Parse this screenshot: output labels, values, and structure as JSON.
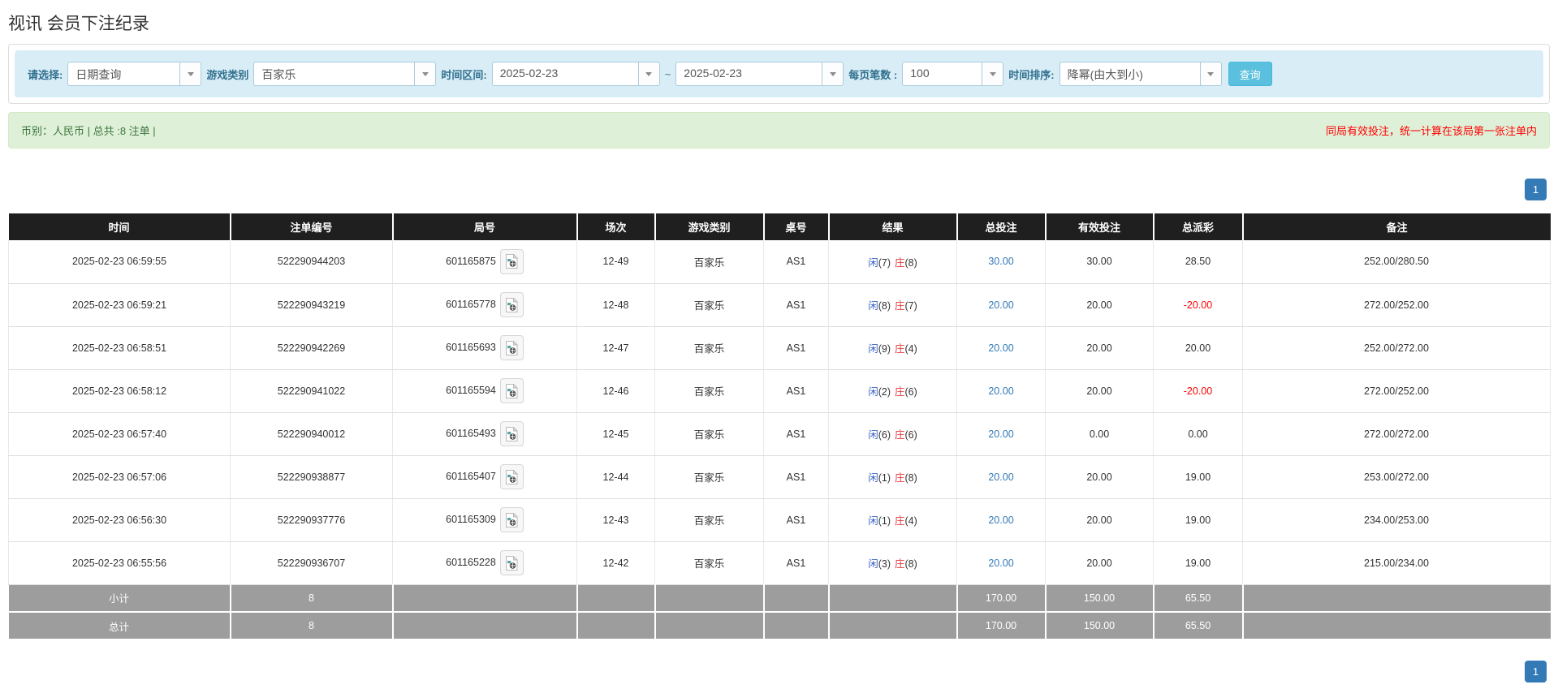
{
  "page_title": "视讯 会员下注纪录",
  "filters": {
    "query_type": {
      "label": "请选择:",
      "value": "日期查询"
    },
    "game_type": {
      "label": "游戏类别",
      "value": "百家乐"
    },
    "date_range": {
      "label": "时间区间:",
      "from": "2025-02-23",
      "separator": "~",
      "to": "2025-02-23"
    },
    "page_size": {
      "label": "每页笔数 :",
      "value": "100"
    },
    "sort": {
      "label": "时间排序:",
      "value": "降幂(由大到小)"
    },
    "query_button_label": "查询"
  },
  "info_bar": {
    "summary": "币别：人民币 | 总共 :8 注单 |",
    "notice": "同局有效投注，统一计算在该局第一张注单内"
  },
  "pagination": {
    "current": "1"
  },
  "table": {
    "headers": [
      "时间",
      "注单编号",
      "局号",
      "场次",
      "游戏类别",
      "桌号",
      "结果",
      "总投注",
      "有效投注",
      "总派彩",
      "备注"
    ],
    "rows": [
      {
        "time": "2025-02-23 06:59:55",
        "bet_id": "522290944203",
        "round_id": "601165875",
        "session": "12-49",
        "game": "百家乐",
        "table_no": "AS1",
        "result": {
          "player_label": "闲",
          "player_score": "(7)",
          "banker_label": "庄",
          "banker_score": "(8)"
        },
        "total_bet": "30.00",
        "valid_bet": "30.00",
        "payout": "28.50",
        "remark": "252.00/280.50"
      },
      {
        "time": "2025-02-23 06:59:21",
        "bet_id": "522290943219",
        "round_id": "601165778",
        "session": "12-48",
        "game": "百家乐",
        "table_no": "AS1",
        "result": {
          "player_label": "闲",
          "player_score": "(8)",
          "banker_label": "庄",
          "banker_score": "(7)"
        },
        "total_bet": "20.00",
        "valid_bet": "20.00",
        "payout": "-20.00",
        "remark": "272.00/252.00"
      },
      {
        "time": "2025-02-23 06:58:51",
        "bet_id": "522290942269",
        "round_id": "601165693",
        "session": "12-47",
        "game": "百家乐",
        "table_no": "AS1",
        "result": {
          "player_label": "闲",
          "player_score": "(9)",
          "banker_label": "庄",
          "banker_score": "(4)"
        },
        "total_bet": "20.00",
        "valid_bet": "20.00",
        "payout": "20.00",
        "remark": "252.00/272.00"
      },
      {
        "time": "2025-02-23 06:58:12",
        "bet_id": "522290941022",
        "round_id": "601165594",
        "session": "12-46",
        "game": "百家乐",
        "table_no": "AS1",
        "result": {
          "player_label": "闲",
          "player_score": "(2)",
          "banker_label": "庄",
          "banker_score": "(6)"
        },
        "total_bet": "20.00",
        "valid_bet": "20.00",
        "payout": "-20.00",
        "remark": "272.00/252.00"
      },
      {
        "time": "2025-02-23 06:57:40",
        "bet_id": "522290940012",
        "round_id": "601165493",
        "session": "12-45",
        "game": "百家乐",
        "table_no": "AS1",
        "result": {
          "player_label": "闲",
          "player_score": "(6)",
          "banker_label": "庄",
          "banker_score": "(6)"
        },
        "total_bet": "20.00",
        "valid_bet": "0.00",
        "payout": "0.00",
        "remark": "272.00/272.00"
      },
      {
        "time": "2025-02-23 06:57:06",
        "bet_id": "522290938877",
        "round_id": "601165407",
        "session": "12-44",
        "game": "百家乐",
        "table_no": "AS1",
        "result": {
          "player_label": "闲",
          "player_score": "(1)",
          "banker_label": "庄",
          "banker_score": "(8)"
        },
        "total_bet": "20.00",
        "valid_bet": "20.00",
        "payout": "19.00",
        "remark": "253.00/272.00"
      },
      {
        "time": "2025-02-23 06:56:30",
        "bet_id": "522290937776",
        "round_id": "601165309",
        "session": "12-43",
        "game": "百家乐",
        "table_no": "AS1",
        "result": {
          "player_label": "闲",
          "player_score": "(1)",
          "banker_label": "庄",
          "banker_score": "(4)"
        },
        "total_bet": "20.00",
        "valid_bet": "20.00",
        "payout": "19.00",
        "remark": "234.00/253.00"
      },
      {
        "time": "2025-02-23 06:55:56",
        "bet_id": "522290936707",
        "round_id": "601165228",
        "session": "12-42",
        "game": "百家乐",
        "table_no": "AS1",
        "result": {
          "player_label": "闲",
          "player_score": "(3)",
          "banker_label": "庄",
          "banker_score": "(8)"
        },
        "total_bet": "20.00",
        "valid_bet": "20.00",
        "payout": "19.00",
        "remark": "215.00/234.00"
      }
    ],
    "subtotal": {
      "label": "小计",
      "count": "8",
      "total_bet": "170.00",
      "valid_bet": "150.00",
      "payout": "65.50"
    },
    "total": {
      "label": "总计",
      "count": "8",
      "total_bet": "170.00",
      "valid_bet": "150.00",
      "payout": "65.50"
    }
  },
  "icons": {
    "select_caret": "chevron-down-icon",
    "round_video": "video-file-icon"
  },
  "colors": {
    "accent": "#337ab7",
    "link": "#337ab7",
    "neg": "#ff0000",
    "player": "#3c63c8",
    "banker": "#e4393c",
    "header_bg": "#1f1f1f",
    "summary_bg": "#9d9d9d",
    "filter_bg": "#d9edf7",
    "info_bg": "#dff0d8",
    "info_text": "#3c763d",
    "btn_info": "#5bc0de"
  }
}
